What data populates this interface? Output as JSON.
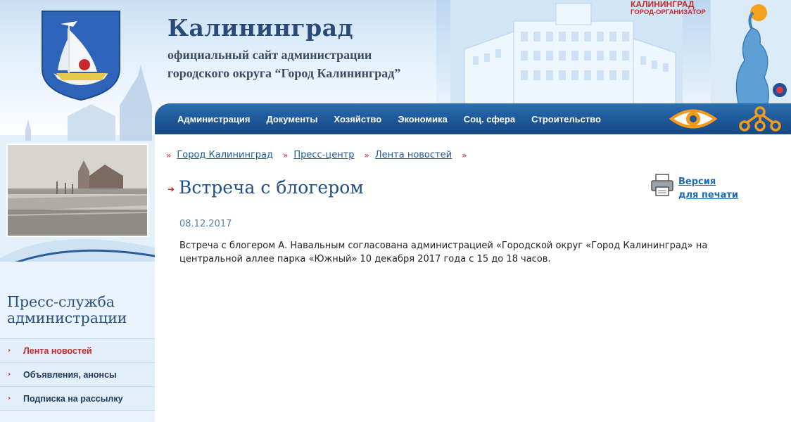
{
  "header": {
    "site_name": "Калининград",
    "subtitle_line1": "официальный сайт администрации",
    "subtitle_line2": "городского округа “Город Калининград”",
    "organizer_line1": "КАЛИНИНГРАД",
    "organizer_line2": "ГОРОД-ОРГАНИЗАТОР"
  },
  "nav": {
    "items": [
      {
        "label": "Администрация"
      },
      {
        "label": "Документы"
      },
      {
        "label": "Хозяйство"
      },
      {
        "label": "Экономика"
      },
      {
        "label": "Соц. сфера"
      },
      {
        "label": "Строительство"
      }
    ],
    "icons": [
      "eye-icon",
      "sitemap-icon"
    ]
  },
  "sidebar": {
    "section_title_line1": "Пресс-служба",
    "section_title_line2": "администрации",
    "items": [
      {
        "label": "Лента новостей",
        "active": true
      },
      {
        "label": "Объявления, анонсы",
        "active": false
      },
      {
        "label": "Подписка на рассылку",
        "active": false
      }
    ]
  },
  "breadcrumb": [
    {
      "label": "Город Калининград"
    },
    {
      "label": "Пресс-центр"
    },
    {
      "label": "Лента новостей"
    }
  ],
  "article": {
    "title": "Встреча с блогером",
    "date": "08.12.2017",
    "text": "Встреча с блогером А. Навальным согласована администрацией «Городской округ «Город Калининград» на центральной аллее парка «Южный» 10 декабря 2017 года с 15 до 18 часов."
  },
  "print": {
    "label_line1": "Версия",
    "label_line2": "для печати"
  },
  "colors": {
    "nav_blue": "#1d5797",
    "accent_red": "#c62a2a",
    "link_blue": "#1d5a9a",
    "title_blue": "#1f4f86"
  }
}
